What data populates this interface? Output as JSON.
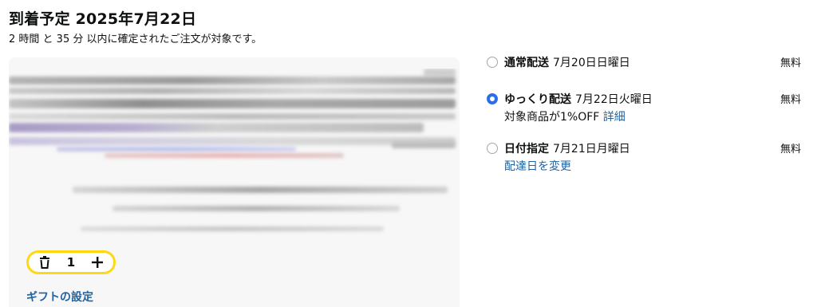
{
  "delivery_header": {
    "title": "到着予定 2025年7月22日",
    "subtitle": "2 時間 と 35 分 以内に確定されたご注文が対象です。"
  },
  "cart_item": {
    "quantity": "1",
    "gift_link": "ギフトの設定"
  },
  "shipping_options": [
    {
      "name": "通常配送",
      "date": "7月20日日曜日",
      "price": "無料",
      "selected": false
    },
    {
      "name": "ゆっくり配送",
      "date": "7月22日火曜日",
      "price": "無料",
      "selected": true,
      "note": "対象商品が1%OFF",
      "note_link": "詳細"
    },
    {
      "name": "日付指定",
      "date": "7月21日月曜日",
      "price": "無料",
      "selected": false,
      "link": "配達日を変更"
    }
  ],
  "colors": {
    "accent_blue": "#2a6fe8",
    "link_blue": "#2162a1",
    "stepper_yellow": "#ffd814",
    "card_bg": "#f7f7f7"
  },
  "icons": {
    "delete": "trash-icon",
    "increase": "plus-icon"
  }
}
